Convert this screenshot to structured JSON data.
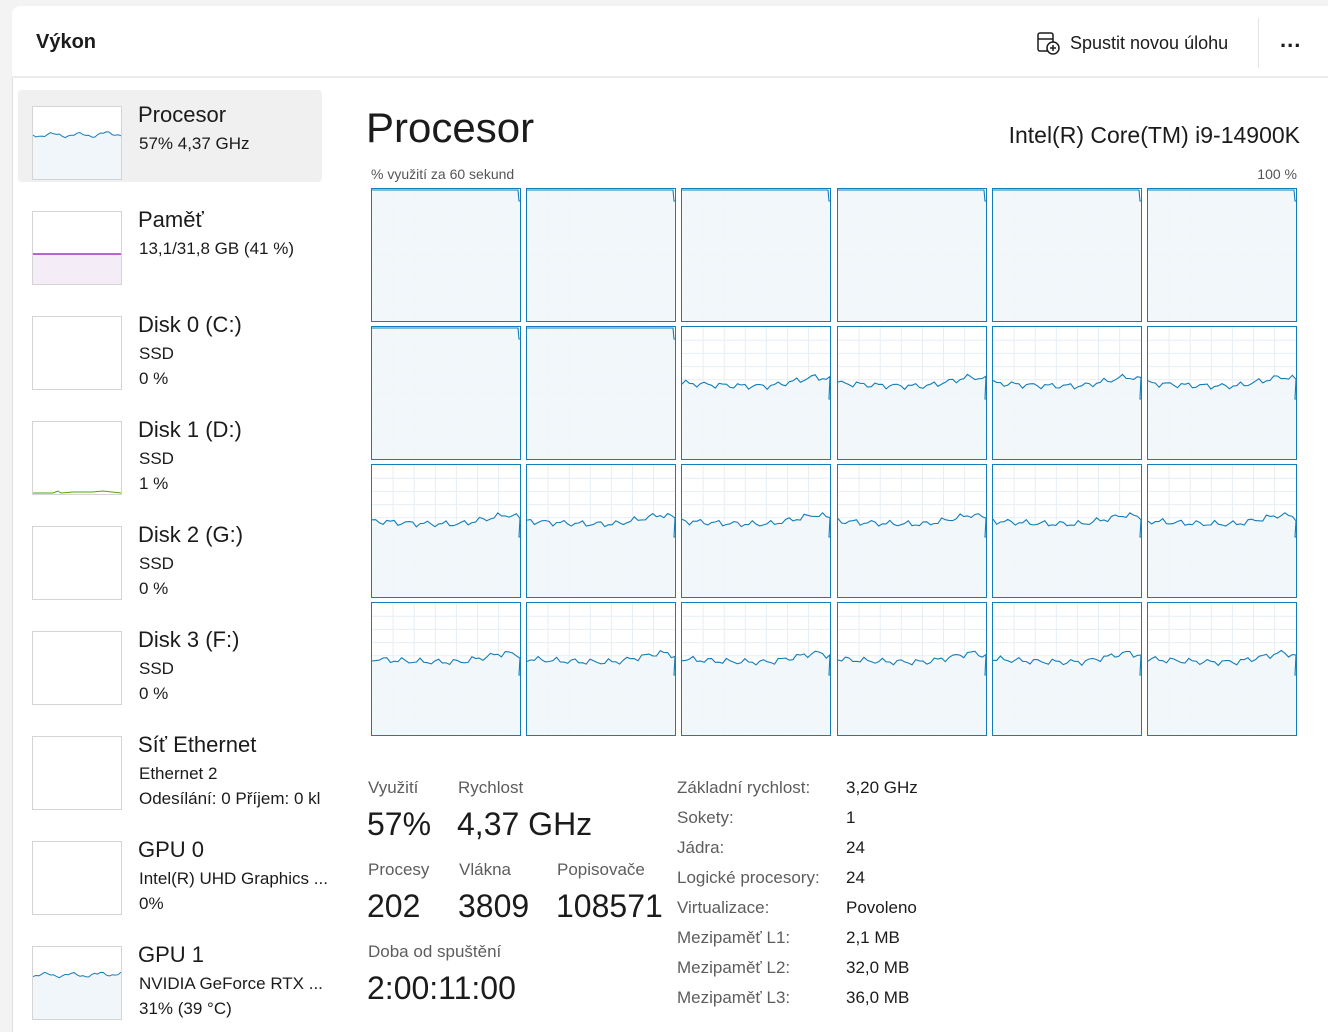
{
  "header": {
    "title": "Výkon",
    "run_task_label": "Spustit novou úlohu",
    "more_label": "..."
  },
  "sidebar": {
    "items": [
      {
        "title": "Procesor",
        "sub1": "57%  4,37 GHz",
        "sub2": "",
        "selected": true,
        "graph": "cpu",
        "color": "#117dbb"
      },
      {
        "title": "Paměť",
        "sub1": "13,1/31,8 GB (41 %)",
        "sub2": "",
        "graph": "mem",
        "color": "#8b12ae"
      },
      {
        "title": "Disk 0 (C:)",
        "sub1": "SSD",
        "sub2": "0 %",
        "graph": "empty",
        "color": "#4da60c"
      },
      {
        "title": "Disk 1 (D:)",
        "sub1": "SSD",
        "sub2": "1 %",
        "graph": "disk",
        "color": "#4da60c"
      },
      {
        "title": "Disk 2 (G:)",
        "sub1": "SSD",
        "sub2": "0 %",
        "graph": "empty",
        "color": "#4da60c"
      },
      {
        "title": "Disk 3 (F:)",
        "sub1": "SSD",
        "sub2": "0 %",
        "graph": "empty",
        "color": "#4da60c"
      },
      {
        "title": "Síť Ethernet",
        "sub1": "Ethernet 2",
        "sub2": "Odesílání: 0  Příjem: 0 kl",
        "graph": "empty",
        "color": "#a74f01"
      },
      {
        "title": "GPU 0",
        "sub1": "Intel(R) UHD Graphics ...",
        "sub2": "0%",
        "graph": "empty",
        "color": "#117dbb"
      },
      {
        "title": "GPU 1",
        "sub1": "NVIDIA GeForce RTX ...",
        "sub2": "31%  (39 °C)",
        "graph": "cpu",
        "color": "#117dbb"
      }
    ]
  },
  "main": {
    "title": "Procesor",
    "cpu_model": "Intel(R) Core(TM) i9-14900K",
    "graph_caption": "% využití za 60 sekund",
    "graph_max": "100 %",
    "core_count": 24,
    "core_full_count": 8,
    "accent_color": "#117dbb",
    "fill_color": "#f1f6fa"
  },
  "stats": {
    "utilization_label": "Využití",
    "utilization_value": "57%",
    "speed_label": "Rychlost",
    "speed_value": "4,37 GHz",
    "processes_label": "Procesy",
    "processes_value": "202",
    "threads_label": "Vlákna",
    "threads_value": "3809",
    "handles_label": "Popisovače",
    "handles_value": "108571",
    "uptime_label": "Doba od spuštění",
    "uptime_value": "2:00:11:00"
  },
  "info": [
    {
      "label": "Základní rychlost:",
      "value": "3,20 GHz"
    },
    {
      "label": "Sokety:",
      "value": "1"
    },
    {
      "label": "Jádra:",
      "value": "24"
    },
    {
      "label": "Logické procesory:",
      "value": "24"
    },
    {
      "label": "Virtualizace:",
      "value": "Povoleno"
    },
    {
      "label": "Mezipaměť L1:",
      "value": "2,1 MB"
    },
    {
      "label": "Mezipaměť L2:",
      "value": "32,0 MB"
    },
    {
      "label": "Mezipaměť L3:",
      "value": "36,0 MB"
    }
  ]
}
